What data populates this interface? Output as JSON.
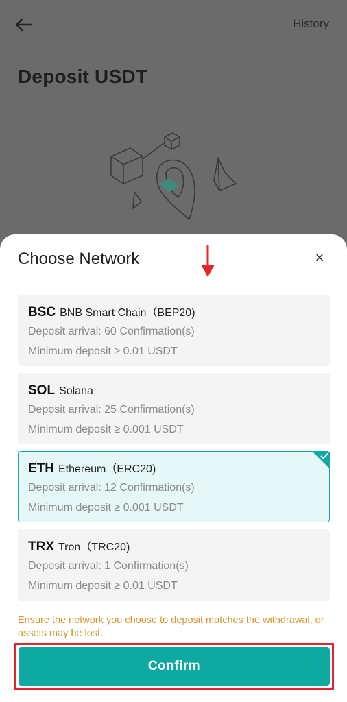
{
  "header": {
    "history_label": "History",
    "title": "Deposit USDT"
  },
  "sheet": {
    "title": "Choose Network",
    "close_symbol": "×",
    "networks": [
      {
        "code": "BSC",
        "name": "BNB Smart Chain（BEP20)",
        "arrival": "Deposit arrival: 60 Confirmation(s)",
        "minimum": "Minimum deposit ≥ 0.01 USDT",
        "selected": false
      },
      {
        "code": "SOL",
        "name": "Solana",
        "arrival": "Deposit arrival: 25 Confirmation(s)",
        "minimum": "Minimum deposit ≥ 0.001 USDT",
        "selected": false
      },
      {
        "code": "ETH",
        "name": "Ethereum（ERC20)",
        "arrival": "Deposit arrival: 12 Confirmation(s)",
        "minimum": "Minimum deposit ≥ 0.001 USDT",
        "selected": true
      },
      {
        "code": "TRX",
        "name": "Tron（TRC20)",
        "arrival": "Deposit arrival: 1 Confirmation(s)",
        "minimum": "Minimum deposit ≥ 0.01 USDT",
        "selected": false
      }
    ],
    "warning": "Ensure the network you choose to deposit matches the withdrawal, or assets may be lost.",
    "confirm_label": "Confirm"
  },
  "colors": {
    "accent": "#0eaaa1",
    "warning": "#d9952c",
    "annotation_red": "#e3262b",
    "overlay": "#6b6b6b"
  },
  "icons": {
    "back": "arrow-left-icon",
    "close": "close-icon",
    "selected": "checkmark-icon",
    "annotation": "red-down-arrow-icon"
  }
}
